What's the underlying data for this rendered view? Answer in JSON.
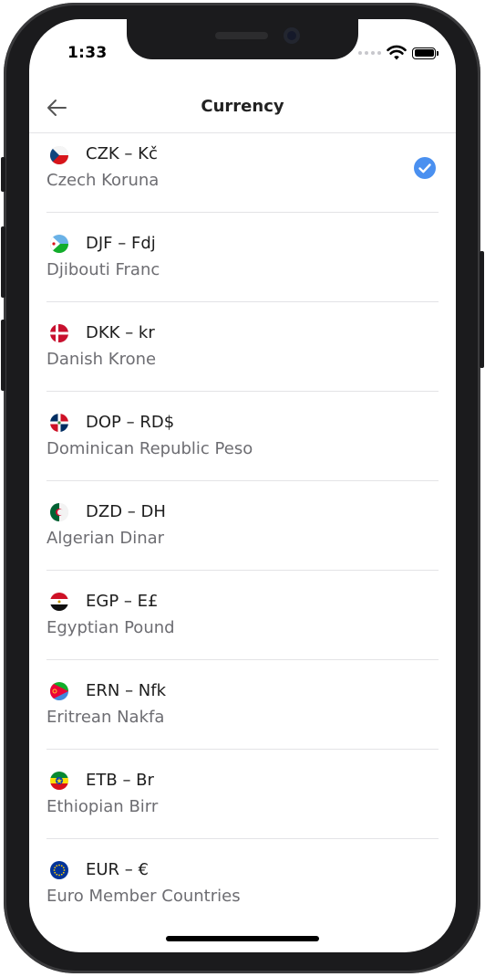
{
  "status_bar": {
    "time": "1:33"
  },
  "nav": {
    "title": "Currency"
  },
  "currencies": [
    {
      "code": "CZK – Kč",
      "name": "Czech Koruna",
      "selected": true,
      "flag": "flag-czech-republic"
    },
    {
      "code": "DJF – Fdj",
      "name": "Djibouti Franc",
      "selected": false,
      "flag": "flag-djibouti"
    },
    {
      "code": "DKK – kr",
      "name": "Danish Krone",
      "selected": false,
      "flag": "flag-denmark"
    },
    {
      "code": "DOP – RD$",
      "name": "Dominican Republic Peso",
      "selected": false,
      "flag": "flag-dominican-republic"
    },
    {
      "code": "DZD – DH",
      "name": "Algerian Dinar",
      "selected": false,
      "flag": "flag-algeria"
    },
    {
      "code": "EGP – E£",
      "name": "Egyptian Pound",
      "selected": false,
      "flag": "flag-egypt"
    },
    {
      "code": "ERN – Nfk",
      "name": "Eritrean Nakfa",
      "selected": false,
      "flag": "flag-eritrea"
    },
    {
      "code": "ETB – Br",
      "name": "Ethiopian Birr",
      "selected": false,
      "flag": "flag-ethiopia"
    },
    {
      "code": "EUR – €",
      "name": "Euro Member Countries",
      "selected": false,
      "flag": "flag-european-union"
    }
  ],
  "colors": {
    "accent": "#4a90f0",
    "divider": "#e3e3e6",
    "secondary_text": "#6d6d72"
  }
}
